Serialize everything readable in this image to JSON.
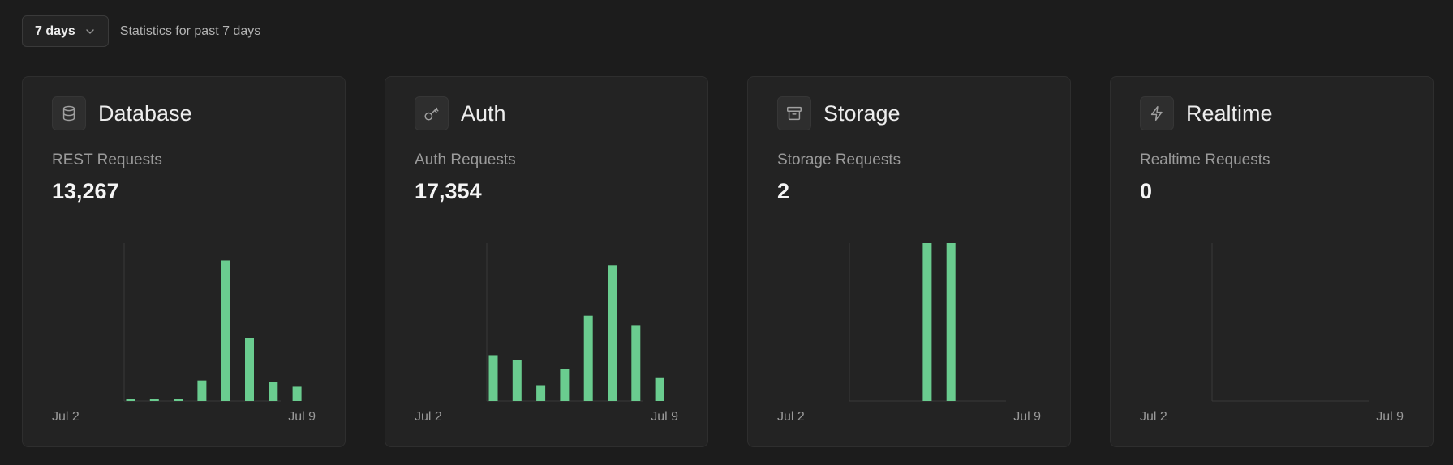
{
  "period": {
    "label": "7 days",
    "description": "Statistics for past 7 days",
    "chevron_icon": "chevron-down-icon"
  },
  "colors": {
    "bar": "#6acc8f",
    "axis": "#3a3a3a"
  },
  "cards": [
    {
      "title": "Database",
      "icon": "database-icon",
      "metric_label": "REST Requests",
      "metric_value": "13,267",
      "x_start": "Jul 2",
      "x_end": "Jul 9"
    },
    {
      "title": "Auth",
      "icon": "key-icon",
      "metric_label": "Auth Requests",
      "metric_value": "17,354",
      "x_start": "Jul 2",
      "x_end": "Jul 9"
    },
    {
      "title": "Storage",
      "icon": "archive-icon",
      "metric_label": "Storage Requests",
      "metric_value": "2",
      "x_start": "Jul 2",
      "x_end": "Jul 9"
    },
    {
      "title": "Realtime",
      "icon": "zap-icon",
      "metric_label": "Realtime Requests",
      "metric_value": "0",
      "x_start": "Jul 2",
      "x_end": "Jul 9"
    }
  ],
  "chart_data": [
    {
      "type": "bar",
      "series": [
        {
          "values": [
            1,
            1,
            1,
            13,
            89,
            40,
            12,
            9
          ]
        }
      ],
      "ylim": [
        0,
        100
      ]
    },
    {
      "type": "bar",
      "series": [
        {
          "values": [
            29,
            26,
            10,
            20,
            54,
            86,
            48,
            15
          ]
        }
      ],
      "ylim": [
        0,
        100
      ]
    },
    {
      "type": "bar",
      "series": [
        {
          "values": [
            0,
            0,
            0,
            1,
            1,
            0,
            0,
            0
          ]
        }
      ],
      "ylim": [
        0,
        1
      ]
    },
    {
      "type": "bar",
      "series": [
        {
          "values": [
            0,
            0,
            0,
            0,
            0,
            0,
            0,
            0
          ]
        }
      ],
      "ylim": [
        0,
        1
      ]
    }
  ]
}
